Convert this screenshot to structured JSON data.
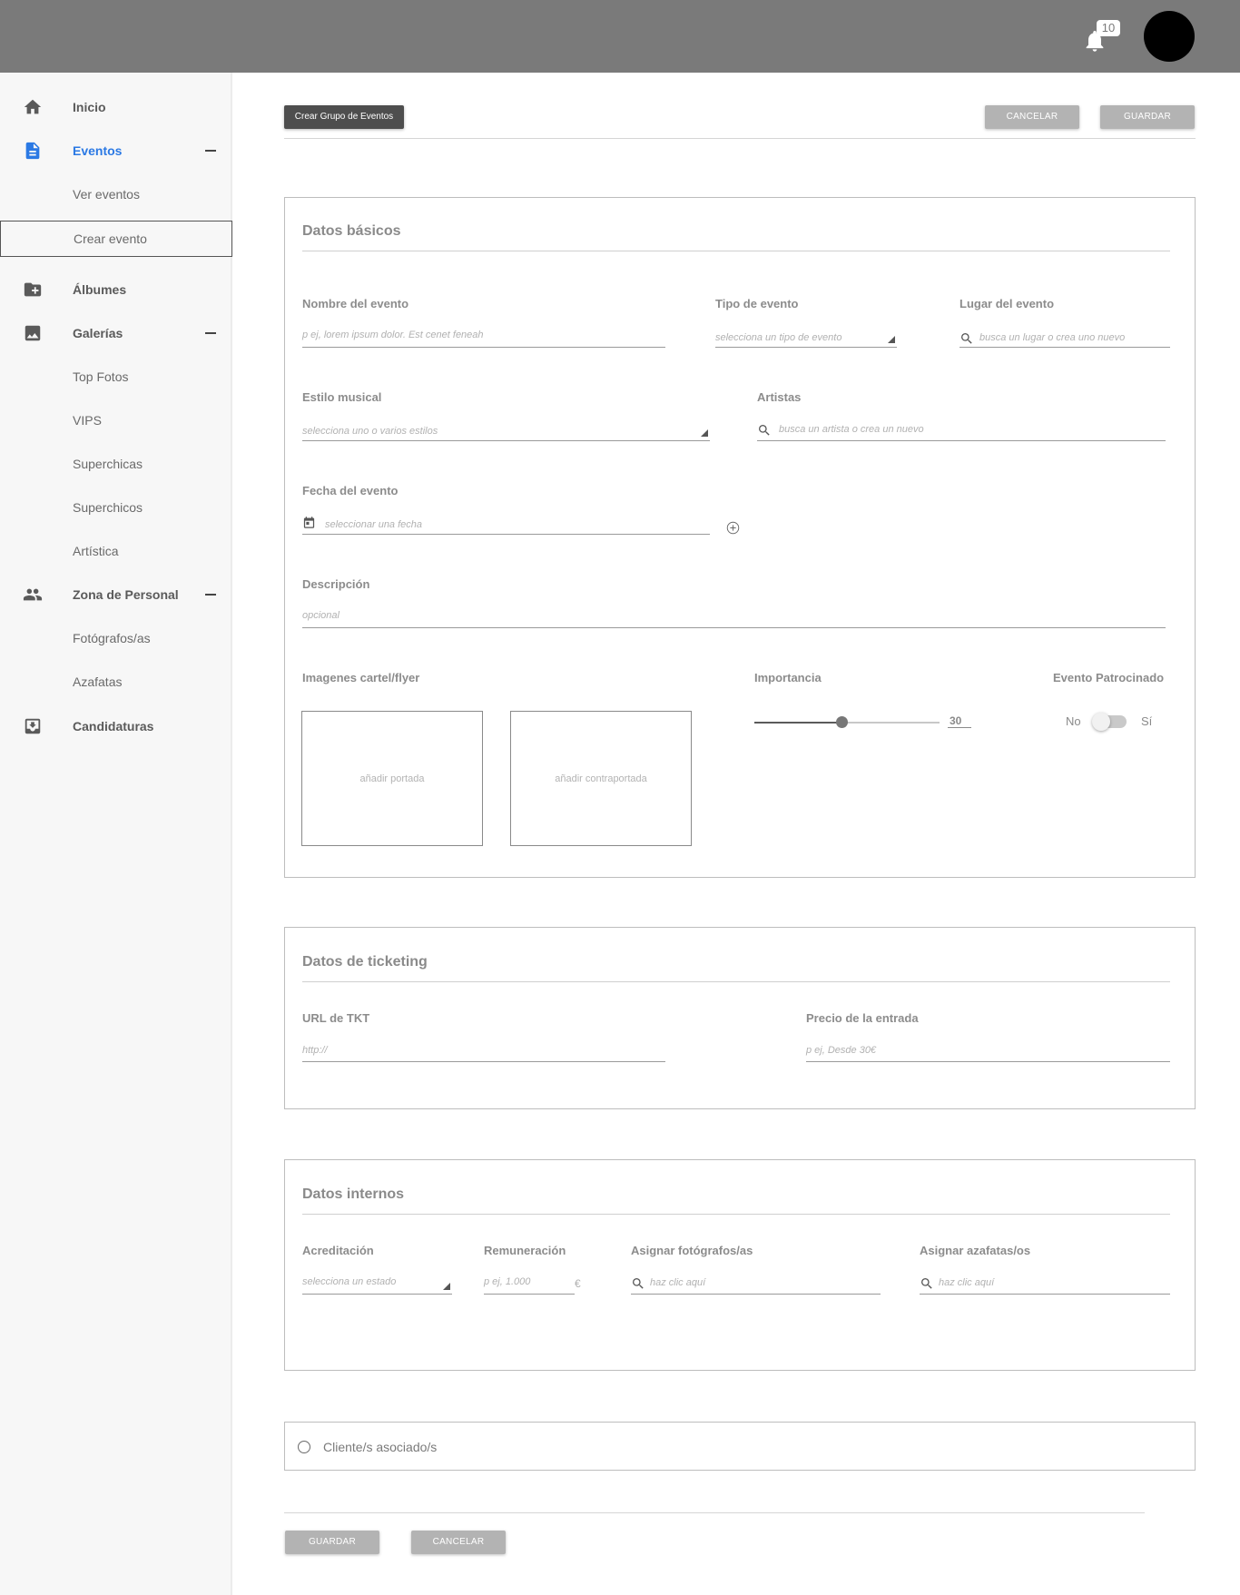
{
  "topbar": {
    "notifications_count": "10"
  },
  "sidebar": {
    "items": [
      {
        "label": "Inicio",
        "icon": "home-icon"
      },
      {
        "label": "Eventos",
        "icon": "document-icon",
        "expanded": true,
        "active": true,
        "children": [
          {
            "label": "Ver eventos"
          },
          {
            "label": "Crear evento",
            "selected": true
          }
        ]
      },
      {
        "label": "Álbumes",
        "icon": "folder-add-icon"
      },
      {
        "label": "Galerías",
        "icon": "image-icon",
        "expanded": true,
        "children": [
          {
            "label": "Top Fotos"
          },
          {
            "label": "VIPS"
          },
          {
            "label": "Superchicas"
          },
          {
            "label": "Superchicos"
          },
          {
            "label": "Artística"
          }
        ]
      },
      {
        "label": "Zona de Personal",
        "icon": "people-icon",
        "expanded": true,
        "children": [
          {
            "label": "Fotógrafos/as"
          },
          {
            "label": "Azafatas"
          }
        ]
      },
      {
        "label": "Candidaturas",
        "icon": "inbox-download-icon"
      }
    ]
  },
  "toolbar": {
    "create_group_label": "Crear Grupo de Eventos",
    "cancel_label": "CANCELAR",
    "save_label": "GUARDAR"
  },
  "basic": {
    "title": "Datos básicos",
    "name_label": "Nombre del evento",
    "name_placeholder": "p ej, lorem ipsum dolor. Est cenet feneah",
    "type_label": "Tipo de evento",
    "type_placeholder": "selecciona un tipo de evento",
    "place_label": "Lugar del evento",
    "place_placeholder": "busca un lugar o crea uno nuevo",
    "style_label": "Estilo musical",
    "style_placeholder": "selecciona uno o varios estilos",
    "artists_label": "Artistas",
    "artists_placeholder": "busca un artista o crea un nuevo",
    "date_label": "Fecha del evento",
    "date_placeholder": "seleccionar una fecha",
    "desc_label": "Descripción",
    "desc_placeholder": "opcional",
    "images_label": "Imagenes cartel/flyer",
    "cover_label": "añadir portada",
    "backcover_label": "añadir contraportada",
    "importance_label": "Importancia",
    "importance_value": "30",
    "importance_fraction": 0.47,
    "sponsored_label": "Evento Patrocinado",
    "toggle_no": "No",
    "toggle_yes": "Sí",
    "sponsored_on": false
  },
  "ticketing": {
    "title": "Datos de ticketing",
    "url_label": "URL de TKT",
    "url_placeholder": "http://",
    "price_label": "Precio de la entrada",
    "price_placeholder": "p ej, Desde 30€"
  },
  "internal": {
    "title": "Datos internos",
    "accred_label": "Acreditación",
    "accred_placeholder": "selecciona un estado",
    "pay_label": "Remuneración",
    "pay_placeholder": "p ej, 1.000",
    "currency": "€",
    "photographers_label": "Asignar fotógrafos/as",
    "photographers_placeholder": "haz clic aquí",
    "hostesses_label": "Asignar azafatas/os",
    "hostesses_placeholder": "haz clic aquí"
  },
  "clients": {
    "label": "Cliente/s asociado/s"
  },
  "footer": {
    "save_label": "GUARDAR",
    "cancel_label": "CANCELAR"
  }
}
